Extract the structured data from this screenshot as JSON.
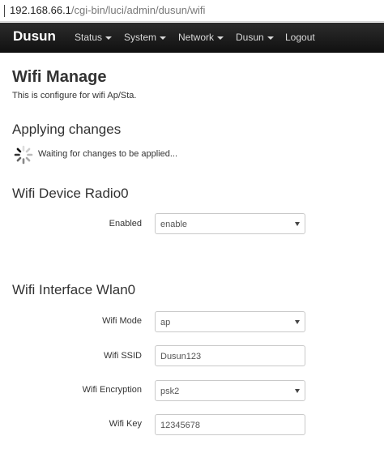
{
  "address_bar": {
    "host": "192.168.66.1",
    "path": "/cgi-bin/luci/admin/dusun/wifi"
  },
  "navbar": {
    "brand": "Dusun",
    "items": [
      {
        "label": "Status"
      },
      {
        "label": "System"
      },
      {
        "label": "Network"
      },
      {
        "label": "Dusun"
      },
      {
        "label": "Logout"
      }
    ]
  },
  "page": {
    "title": "Wifi Manage",
    "description": "This is configure for wifi Ap/Sta."
  },
  "applying": {
    "heading": "Applying changes",
    "status": "Waiting for changes to be applied..."
  },
  "radio_section": {
    "heading": "Wifi Device Radio0",
    "enabled_label": "Enabled",
    "enabled_value": "enable"
  },
  "interface_section": {
    "heading": "Wifi Interface Wlan0",
    "mode_label": "Wifi Mode",
    "mode_value": "ap",
    "ssid_label": "Wifi SSID",
    "ssid_value": "Dusun123",
    "encryption_label": "Wifi Encryption",
    "encryption_value": "psk2",
    "key_label": "Wifi Key",
    "key_value": "12345678"
  }
}
